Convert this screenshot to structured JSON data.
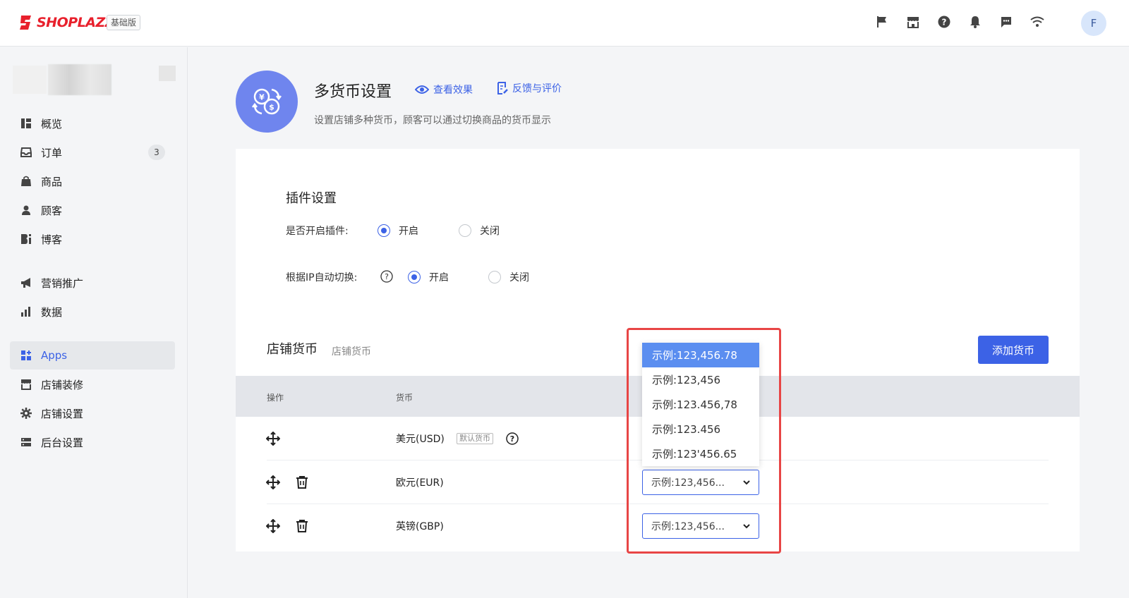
{
  "brand": {
    "name": "SHOPLAZZA",
    "plan": "基础版",
    "accent": "#e8202c"
  },
  "topbar": {
    "icons": [
      "flag-icon",
      "store-icon",
      "help-icon",
      "bell-icon",
      "message-icon",
      "wifi-icon"
    ],
    "avatar_letter": "F"
  },
  "sidebar": {
    "items": [
      {
        "label": "概览",
        "icon": "dashboard-icon"
      },
      {
        "label": "订单",
        "icon": "inbox-icon",
        "badge": "3"
      },
      {
        "label": "商品",
        "icon": "bag-icon"
      },
      {
        "label": "顾客",
        "icon": "person-icon"
      },
      {
        "label": "博客",
        "icon": "blog-icon"
      },
      {
        "label": "营销推广",
        "icon": "megaphone-icon"
      },
      {
        "label": "数据",
        "icon": "bar-chart-icon"
      },
      {
        "label": "Apps",
        "icon": "apps-icon",
        "active": true
      },
      {
        "label": "店铺装修",
        "icon": "storefront-icon"
      },
      {
        "label": "店铺设置",
        "icon": "gear-icon"
      },
      {
        "label": "后台设置",
        "icon": "server-icon"
      }
    ]
  },
  "header": {
    "title": "多货币设置",
    "view_link": "查看效果",
    "feedback_link": "反馈与评价",
    "description": "设置店铺多种货币，顾客可以通过切换商品的货币显示"
  },
  "plugin_settings": {
    "title": "插件设置",
    "enable_label": "是否开启插件:",
    "auto_switch_label": "根据IP自动切换:",
    "on": "开启",
    "off": "关闭"
  },
  "store_currency": {
    "title": "店铺货币",
    "note": "店铺货币",
    "add_button": "添加货币",
    "columns": [
      "操作",
      "货币"
    ],
    "rows": [
      {
        "name": "美元(USD)",
        "tag": "默认货币"
      },
      {
        "name": "欧元(EUR)",
        "format": "示例:123,456..."
      },
      {
        "name": "英镑(GBP)",
        "format": "示例:123,456..."
      }
    ]
  },
  "format_dropdown": {
    "options": [
      "示例:123,456.78",
      "示例:123,456",
      "示例:123.456,78",
      "示例:123.456",
      "示例:123'456.65"
    ],
    "selected_index": 0
  }
}
